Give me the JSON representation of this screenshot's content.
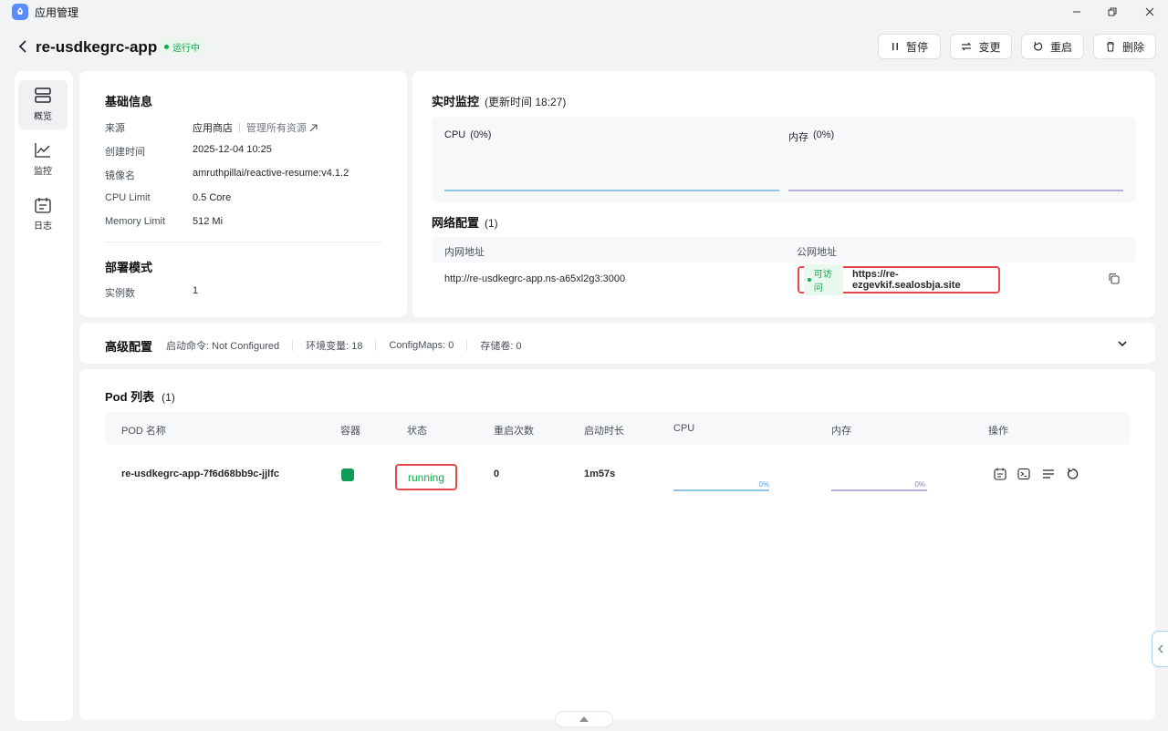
{
  "window": {
    "title": "应用管理"
  },
  "header": {
    "app_name": "re-usdkegrc-app",
    "status": "运行中",
    "buttons": {
      "pause": "暂停",
      "change": "变更",
      "restart": "重启",
      "delete": "删除"
    }
  },
  "sidenav": {
    "overview": "概览",
    "monitor": "监控",
    "logs": "日志"
  },
  "basic": {
    "title": "基础信息",
    "source_label": "来源",
    "source_value": "应用商店",
    "source_link": "管理所有资源",
    "created_label": "创建时间",
    "created_value": "2025-12-04 10:25",
    "image_label": "镜像名",
    "image_value": "amruthpillai/reactive-resume:v4.1.2",
    "cpu_label": "CPU Limit",
    "cpu_value": "0.5 Core",
    "mem_label": "Memory Limit",
    "mem_value": "512 Mi",
    "deploy_title": "部署模式",
    "replicas_label": "实例数",
    "replicas_value": "1"
  },
  "monitor": {
    "title": "实时监控",
    "updated": "(更新时间  18:27)",
    "cpu_label": "CPU",
    "cpu_value": "(0%)",
    "mem_label": "内存",
    "mem_value": "(0%)"
  },
  "network": {
    "title": "网络配置",
    "count": "(1)",
    "col_internal": "内网地址",
    "col_public": "公网地址",
    "internal_url": "http://re-usdkegrc-app.ns-a65xl2g3:3000",
    "accessible": "可访问",
    "public_url": "https://re-ezgevkif.sealosbja.site"
  },
  "advanced": {
    "title": "高级配置",
    "cmd": "启动命令: Not Configured",
    "env": "环境变量: 18",
    "configmaps": "ConfigMaps: 0",
    "storage": "存储卷: 0"
  },
  "pods": {
    "title": "Pod 列表",
    "count": "(1)",
    "columns": [
      "POD 名称",
      "容器",
      "状态",
      "重启次数",
      "启动时长",
      "CPU",
      "内存",
      "操作"
    ],
    "rows": [
      {
        "name": "re-usdkegrc-app-7f6d68bb9c-jjlfc",
        "status": "running",
        "restarts": "0",
        "uptime": "1m57s",
        "cpu": "0%",
        "mem": "0%"
      }
    ]
  },
  "colors": {
    "accent": "#10a84a",
    "highlight": "#e5484d",
    "cpu_line": "#8cc8e6",
    "mem_line": "#b6aee0"
  }
}
